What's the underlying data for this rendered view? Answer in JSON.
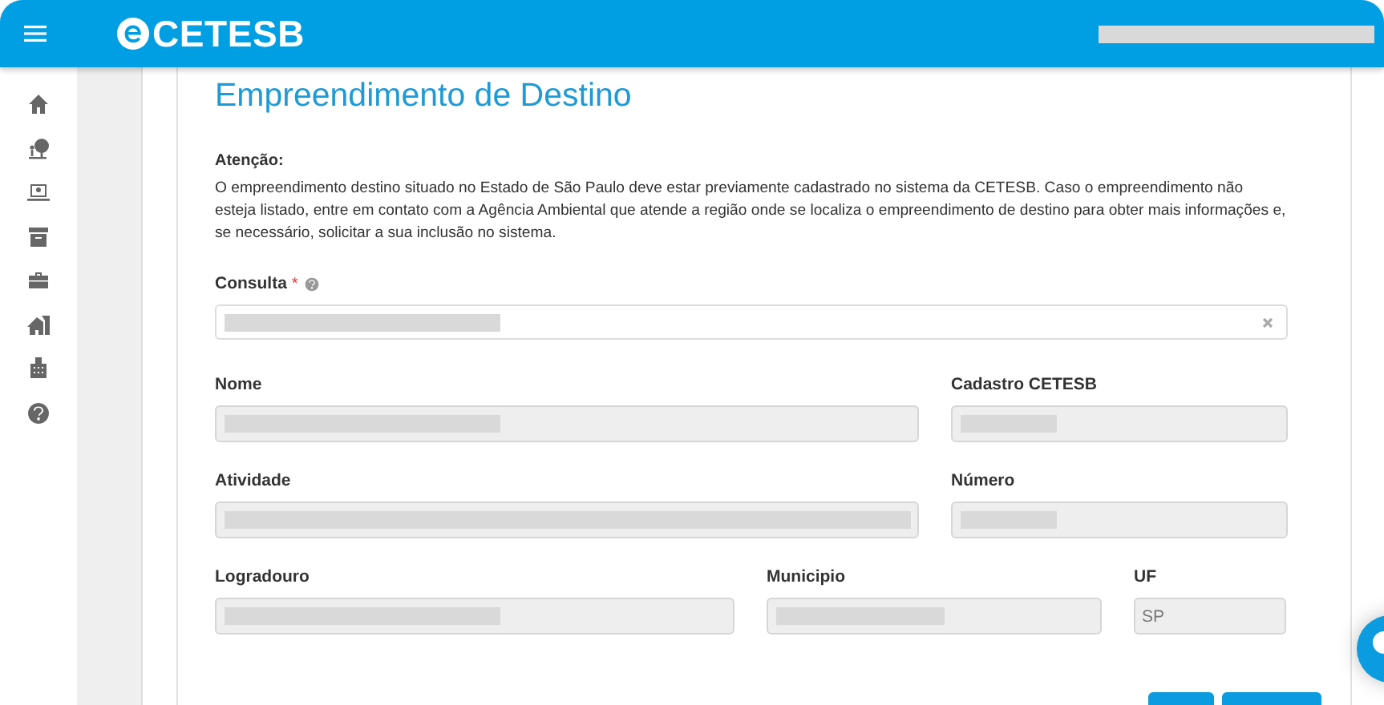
{
  "header": {
    "brand": "CETESB"
  },
  "page": {
    "title": "Empreendimento de Destino",
    "notice_title": "Atenção:",
    "notice_text": "O empreendimento destino situado no Estado de São Paulo deve estar previamente cadastrado no sistema da CETESB. Caso o empreendimento não esteja listado, entre em contato com a Agência Ambiental que atende a região onde se localiza o empreendimento de destino para obter mais informações e, se necessário, solicitar a sua inclusão no sistema."
  },
  "search": {
    "label": "Consulta",
    "required_mark": "*",
    "help": true,
    "clearable": true
  },
  "rows": [
    [
      {
        "label": "Nome",
        "disabled": true
      },
      {
        "label": "Cadastro CETESB",
        "disabled": true
      }
    ],
    [
      {
        "label": "Atividade",
        "disabled": true
      },
      {
        "label": "Número",
        "disabled": true
      }
    ],
    [
      {
        "label": "Logradouro",
        "disabled": true
      },
      {
        "label": "Municipio",
        "disabled": true
      },
      {
        "label": "UF",
        "disabled": true,
        "value": "SP"
      }
    ]
  ]
}
